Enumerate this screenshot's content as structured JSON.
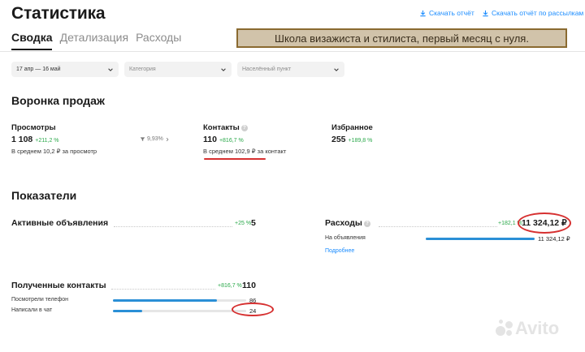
{
  "header": {
    "title": "Статистика",
    "download_report": "Скачать отчёт",
    "download_mailing": "Скачать отчёт по рассылкам"
  },
  "tabs": [
    {
      "label": "Сводка",
      "active": true
    },
    {
      "label": "Детализация",
      "active": false
    },
    {
      "label": "Расходы",
      "active": false
    }
  ],
  "banner": {
    "text": "Школа визажиста и стилиста, первый месяц с нуля."
  },
  "filters": {
    "date": "17 апр — 16 май",
    "category_placeholder": "Категория",
    "city_placeholder": "Населённый пункт"
  },
  "funnel": {
    "title": "Воронка продаж",
    "views": {
      "label": "Просмотры",
      "value": "1 108",
      "delta": "+211,2 %",
      "avg": "В среднем 10,2 ₽ за просмотр"
    },
    "conversion": "9,93%",
    "contacts": {
      "label": "Контакты",
      "value": "110",
      "delta": "+816,7 %",
      "avg": "В среднем 102,9 ₽ за контакт"
    },
    "favorites": {
      "label": "Избранное",
      "value": "255",
      "delta": "+189,8 %"
    }
  },
  "indicators": {
    "title": "Показатели",
    "active_ads": {
      "label": "Активные объявления",
      "delta": "+25 %",
      "value": "5"
    },
    "expenses": {
      "label": "Расходы",
      "delta": "+182,1 %",
      "value": "11 324,12 ₽",
      "ads_label": "На объявления",
      "ads_value": "11 324,12 ₽",
      "ads_fraction": 1.0,
      "more": "Подробнее"
    },
    "contacts": {
      "label": "Полученные контакты",
      "delta": "+816,7 %",
      "value": "110",
      "phone_label": "Посмотрели телефон",
      "phone_value": "86",
      "phone_fraction": 0.78,
      "chat_label": "Написали в чат",
      "chat_value": "24",
      "chat_fraction": 0.22
    }
  },
  "watermark": "Avito",
  "colors": {
    "accent": "#1a8cff",
    "positive": "#2aa84a",
    "annotation": "#d63030",
    "bar": "#2a8fd6"
  }
}
